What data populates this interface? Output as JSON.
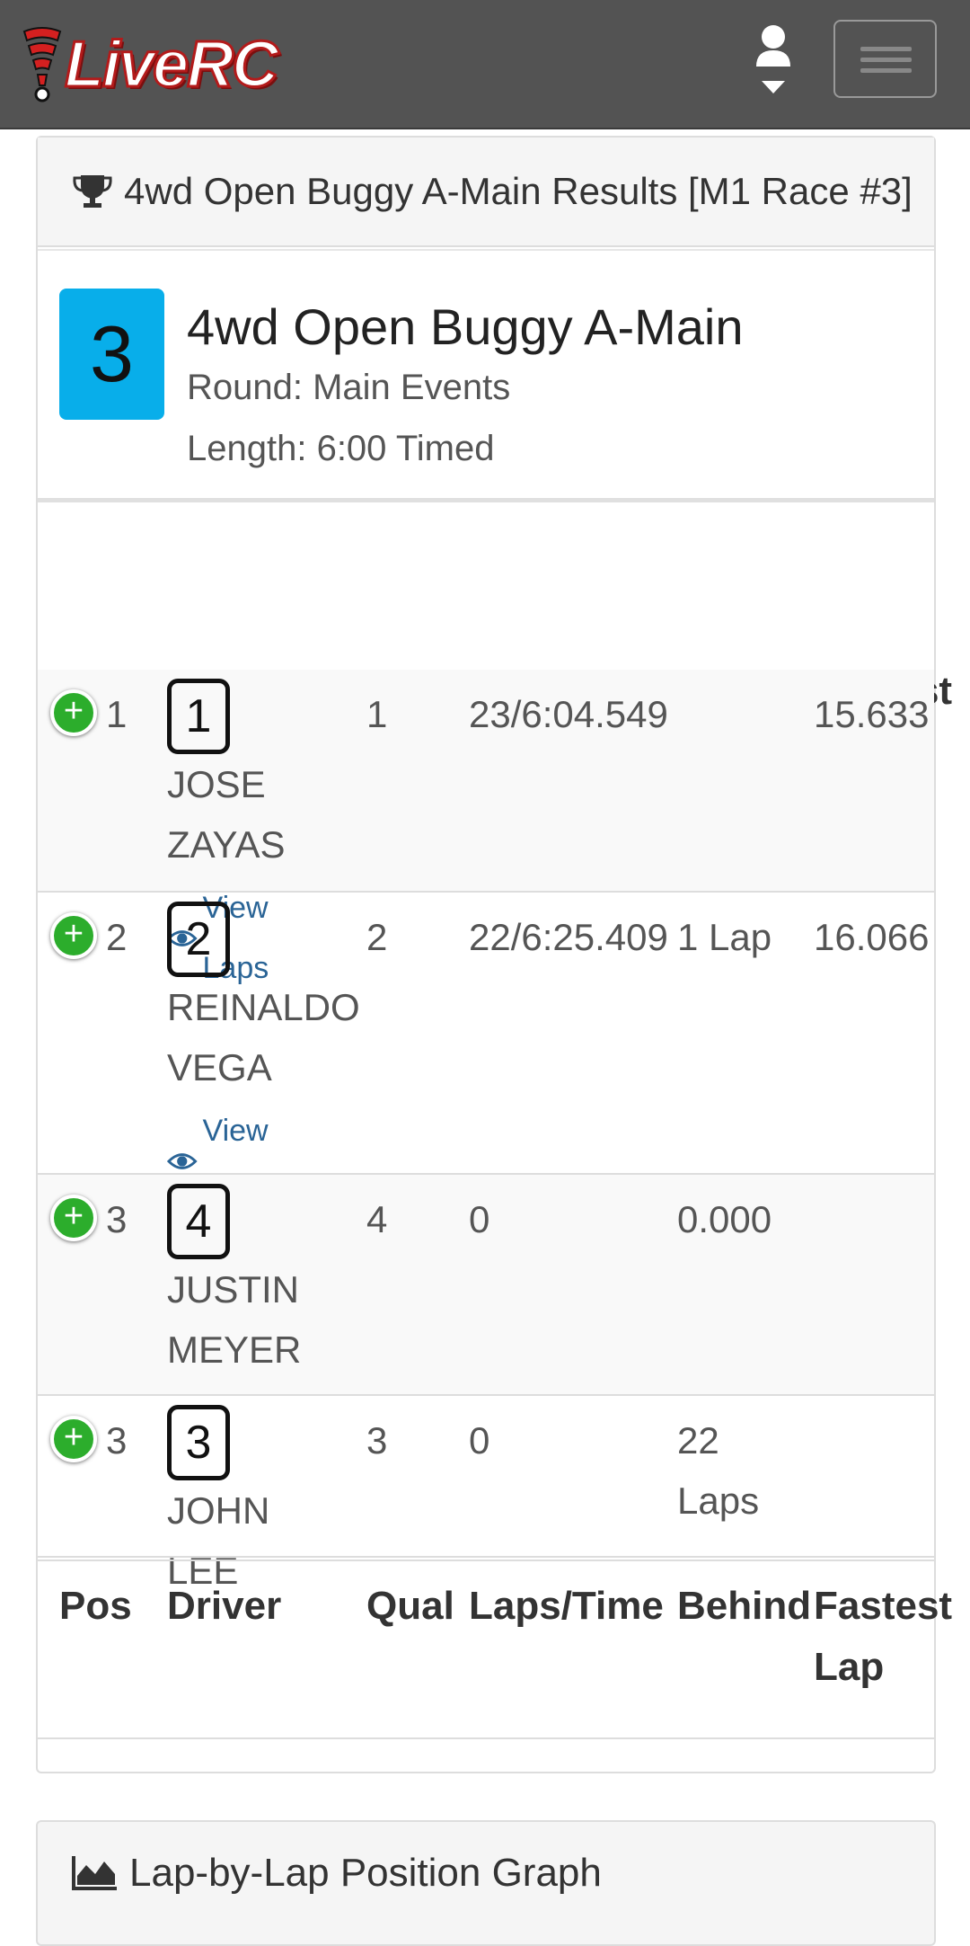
{
  "nav": {
    "brand_live": "Live",
    "brand_rc": "RC"
  },
  "results_panel": {
    "heading": "4wd Open Buggy A-Main Results [M1 Race #3]",
    "race_number": "3",
    "event_title": "4wd Open Buggy A-Main",
    "round": "Round: Main Events",
    "length": "Length: 6:00 Timed"
  },
  "table": {
    "headers": {
      "pos": "Pos",
      "driver": "Driver",
      "qual": "Qual",
      "laps_time": "Laps/Time",
      "behind": "Behind",
      "fastest_1": "Fastest",
      "fastest_2": "Lap"
    },
    "rows": [
      {
        "pos": "1",
        "car": "1",
        "driver_first": "JOSE",
        "driver_last": "ZAYAS",
        "qual": "1",
        "laps_time": "23/6:04.549",
        "behind": "",
        "fastest": "15.633",
        "view_laps": "View Laps"
      },
      {
        "pos": "2",
        "car": "2",
        "driver_first": "REINALDO",
        "driver_last": "VEGA",
        "qual": "2",
        "laps_time": "22/6:25.409",
        "behind": "1 Lap",
        "fastest": "16.066",
        "view_laps": "View Laps"
      },
      {
        "pos": "3",
        "car": "4",
        "driver_first": "JUSTIN",
        "driver_last": "MEYER",
        "qual": "4",
        "laps_time": "0",
        "behind": "0.000",
        "fastest": ""
      },
      {
        "pos": "3",
        "car": "3",
        "driver_first": "JOHN LEE",
        "driver_last": "",
        "qual": "3",
        "laps_time": "0",
        "behind_1": "22",
        "behind_2": "Laps",
        "fastest": ""
      }
    ]
  },
  "graph_panel": {
    "heading": "Lap-by-Lap Position Graph"
  },
  "colors": {
    "navbar": "#535353",
    "race_badge": "#08aeea",
    "plus_button": "#2cad2c",
    "link": "#2a6496"
  }
}
